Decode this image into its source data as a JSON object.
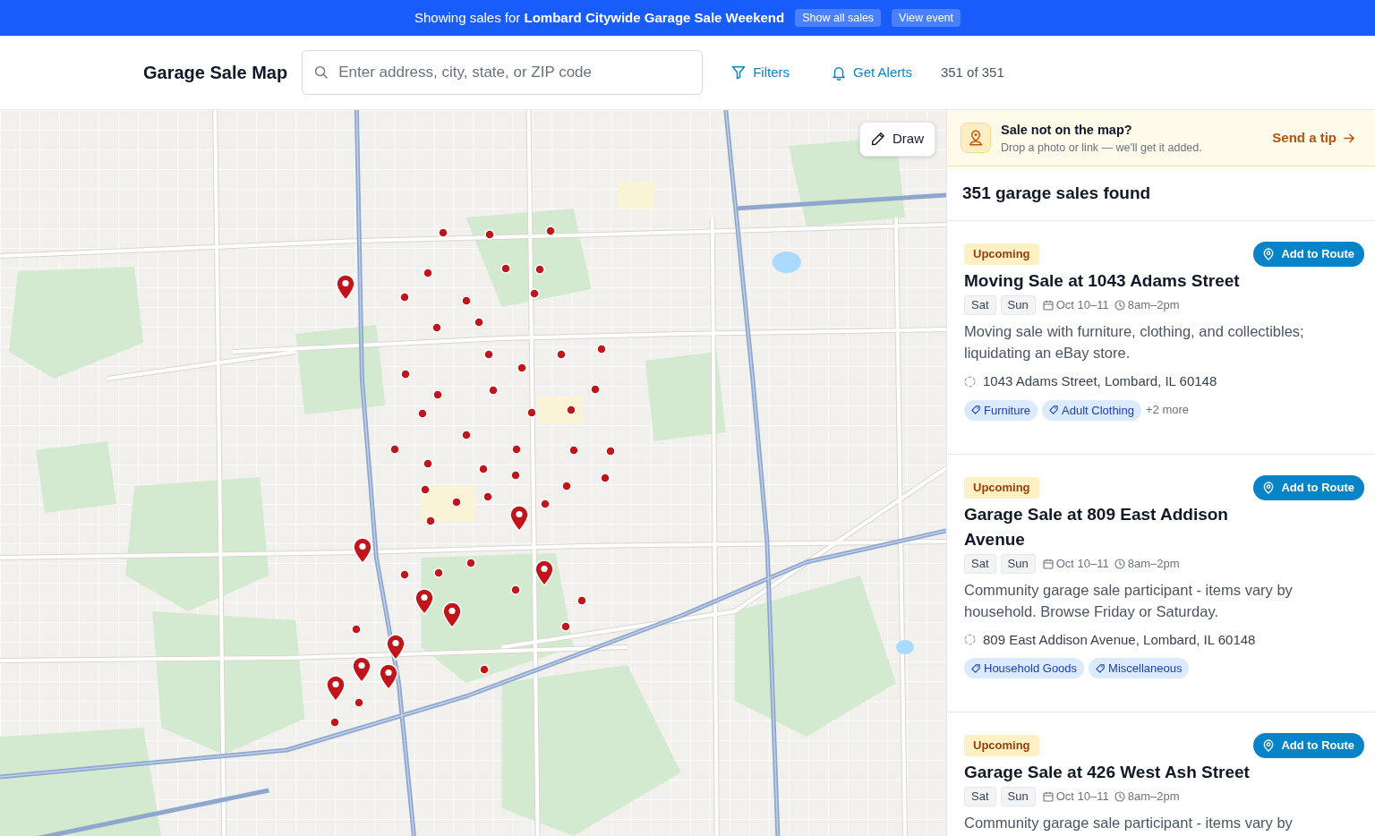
{
  "banner": {
    "text": "Showing sales for **Lombard Citywide Garage Sale Weekend**",
    "buttons": [
      "Show all sales",
      "View event"
    ]
  },
  "header": {
    "title": "Garage Sale Map",
    "search": {
      "placeholder": "Enter address, city, state, or ZIP code"
    },
    "actions": [
      {
        "kind": "filter",
        "label": "Filters"
      },
      {
        "kind": "alert",
        "label": "Get Alerts"
      }
    ],
    "count": "351 of 351"
  },
  "map": {
    "draw_button": "Draw"
  },
  "tip": {
    "title": "Sale not on the map?",
    "subtitle": "Drop a photo or link — we'll get it added.",
    "link": "Send a tip"
  },
  "results": {
    "heading": "351 garage sales found",
    "sales": [
      {
        "status": "Upcoming",
        "button": "Add to Route",
        "title": "Moving Sale at 1043 Adams Street",
        "days": [
          "Sat",
          "Sun"
        ],
        "dates": "Oct 10–11",
        "hours": "8am–2pm",
        "description": "Moving sale with furniture, clothing, and collectibles; liquidating an eBay store.",
        "address": "1043 Adams Street, Lombard, IL 60148",
        "tags": [
          "Furniture",
          "Adult Clothing"
        ],
        "more": "+2 more"
      },
      {
        "status": "Upcoming",
        "button": "Add to Route",
        "title": "Garage Sale at 809 East Addison Avenue",
        "days": [
          "Sat",
          "Sun"
        ],
        "dates": "Oct 10–11",
        "hours": "8am–2pm",
        "description": "Community garage sale participant - items vary by household. Browse Friday or Saturday.",
        "address": "809 East Addison Avenue, Lombard, IL 60148",
        "tags": [
          "Household Goods",
          "Miscellaneous"
        ]
      },
      {
        "status": "Upcoming",
        "button": "Add to Route",
        "title": "Garage Sale at 426 West Ash Street",
        "days": [
          "Sat",
          "Sun"
        ],
        "dates": "Oct 10–11",
        "hours": "8am–2pm",
        "description": "Community garage sale participant - items vary by"
      }
    ]
  }
}
